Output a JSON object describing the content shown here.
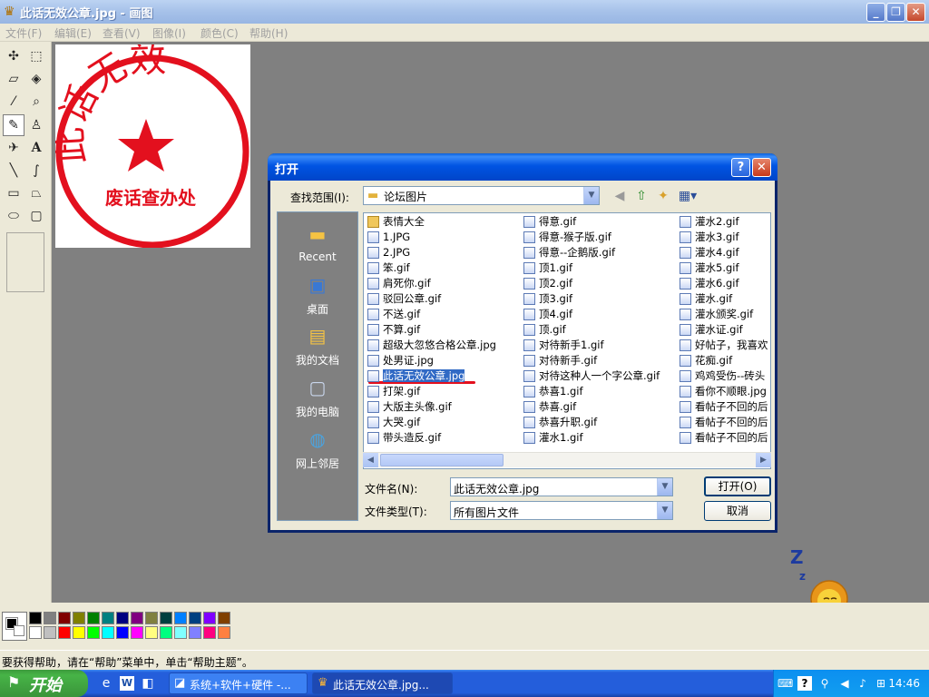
{
  "window": {
    "title": "此话无效公章.jpg - 画图"
  },
  "menu": [
    "文件(F)",
    "编辑(E)",
    "查看(V)",
    "图像(I)",
    "颜色(C)",
    "帮助(H)"
  ],
  "canvas": {
    "stamp_top_text": "此话无效",
    "stamp_bottom_text": "废话查办处",
    "stamp_color": "#e3101e"
  },
  "dialog": {
    "title": "打开",
    "help_glyph": "?",
    "close_glyph": "✕",
    "lookin_label": "查找范围(I):",
    "lookin_value": "论坛图片",
    "places": [
      "Recent",
      "桌面",
      "我的文档",
      "我的电脑",
      "网上邻居"
    ],
    "files_col1": [
      "表情大全",
      "1.JPG",
      "2.JPG",
      "笨.gif",
      "肩死你.gif",
      "驳回公章.gif",
      "不送.gif",
      "不算.gif",
      "超级大忽悠合格公章.jpg",
      "处男证.jpg",
      "此话无效公章.jpg",
      "打架.gif",
      "大版主头像.gif",
      "大哭.gif",
      "带头造反.gif"
    ],
    "files_col2": [
      "得意.gif",
      "得意-猴子版.gif",
      "得意--企鹅版.gif",
      "顶1.gif",
      "顶2.gif",
      "顶3.gif",
      "顶4.gif",
      "顶.gif",
      "对待新手1.gif",
      "对待新手.gif",
      "对待这种人一个字公章.gif",
      "恭喜1.gif",
      "恭喜.gif",
      "恭喜升职.gif",
      "灌水1.gif"
    ],
    "files_col3": [
      "灌水2.gif",
      "灌水3.gif",
      "灌水4.gif",
      "灌水5.gif",
      "灌水6.gif",
      "灌水.gif",
      "灌水颁奖.gif",
      "灌水证.gif",
      "好帖子，我喜欢",
      "花痴.gif",
      "鸡鸡受伤--砖头",
      "看你不顺眼.jpg",
      "看帖子不回的后",
      "看帖子不回的后",
      "看帖子不回的后"
    ],
    "selected_file": "此话无效公章.jpg",
    "filename_label": "文件名(N):",
    "filename_value": "此话无效公章.jpg",
    "filetype_label": "文件类型(T):",
    "filetype_value": "所有图片文件",
    "open_button": "打开(O)",
    "cancel_button": "取消"
  },
  "statusbar": {
    "text": "要获得帮助，请在“帮助”菜单中，单击“帮助主题”。"
  },
  "taskbar": {
    "start_label": "开始",
    "tasks": [
      "系统+软件+硬件 -...",
      "此话无效公章.jpg..."
    ],
    "clock": "14:46"
  },
  "decoration": {
    "zzz_big": "Z",
    "zzz_small": "z"
  }
}
